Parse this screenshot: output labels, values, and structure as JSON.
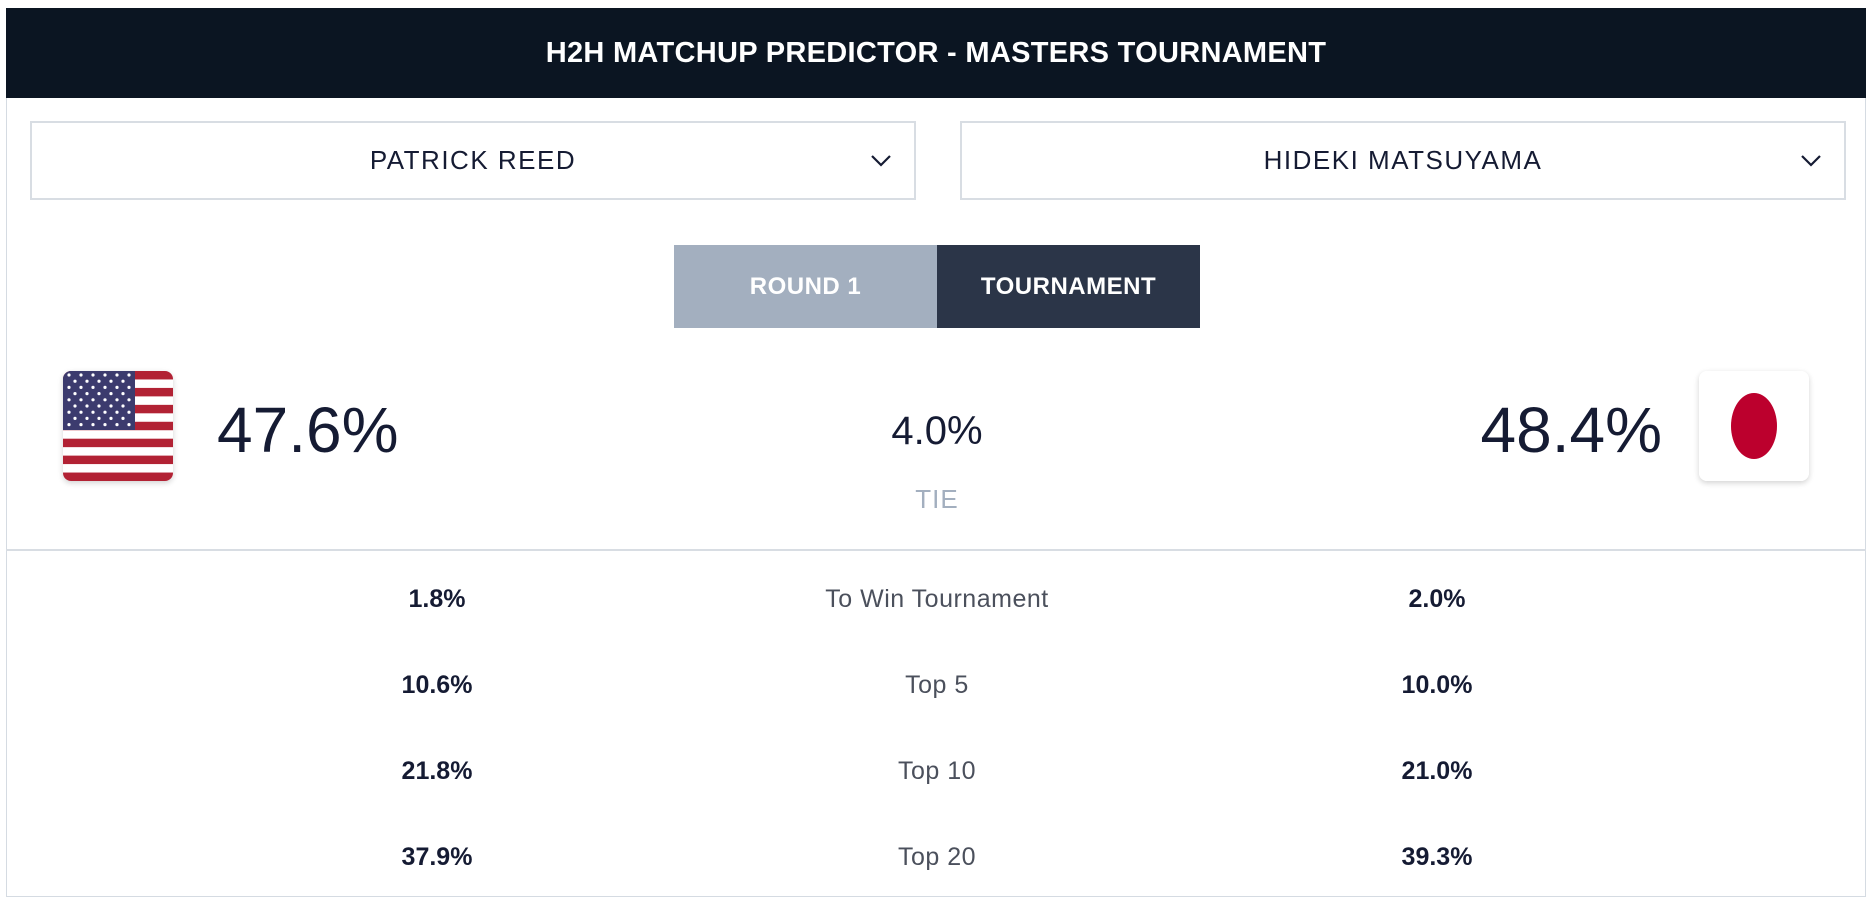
{
  "header": {
    "title": "H2H MATCHUP PREDICTOR - MASTERS TOURNAMENT"
  },
  "players": {
    "left": {
      "name": "PATRICK REED",
      "flag_icon": "usa-flag-icon",
      "win_pct": "47.6%"
    },
    "right": {
      "name": "HIDEKI MATSUYAMA",
      "flag_icon": "japan-flag-icon",
      "win_pct": "48.4%"
    }
  },
  "tabs": [
    {
      "label": "ROUND 1",
      "active": false
    },
    {
      "label": "TOURNAMENT",
      "active": true
    }
  ],
  "tie": {
    "value": "4.0%",
    "label": "TIE"
  },
  "stats": [
    {
      "label": "To Win Tournament",
      "left": "1.8%",
      "right": "2.0%"
    },
    {
      "label": "Top 5",
      "left": "10.6%",
      "right": "10.0%"
    },
    {
      "label": "Top 10",
      "left": "21.8%",
      "right": "21.0%"
    },
    {
      "label": "Top 20",
      "left": "37.9%",
      "right": "39.3%"
    }
  ],
  "colors": {
    "header_bg": "#0b1522",
    "tab_inactive": "#a3afbf",
    "tab_active": "#2b3548",
    "text_dark": "#151b33",
    "japan_red": "#bc002d",
    "usa_red": "#b22234",
    "usa_blue": "#3c3b6e"
  }
}
